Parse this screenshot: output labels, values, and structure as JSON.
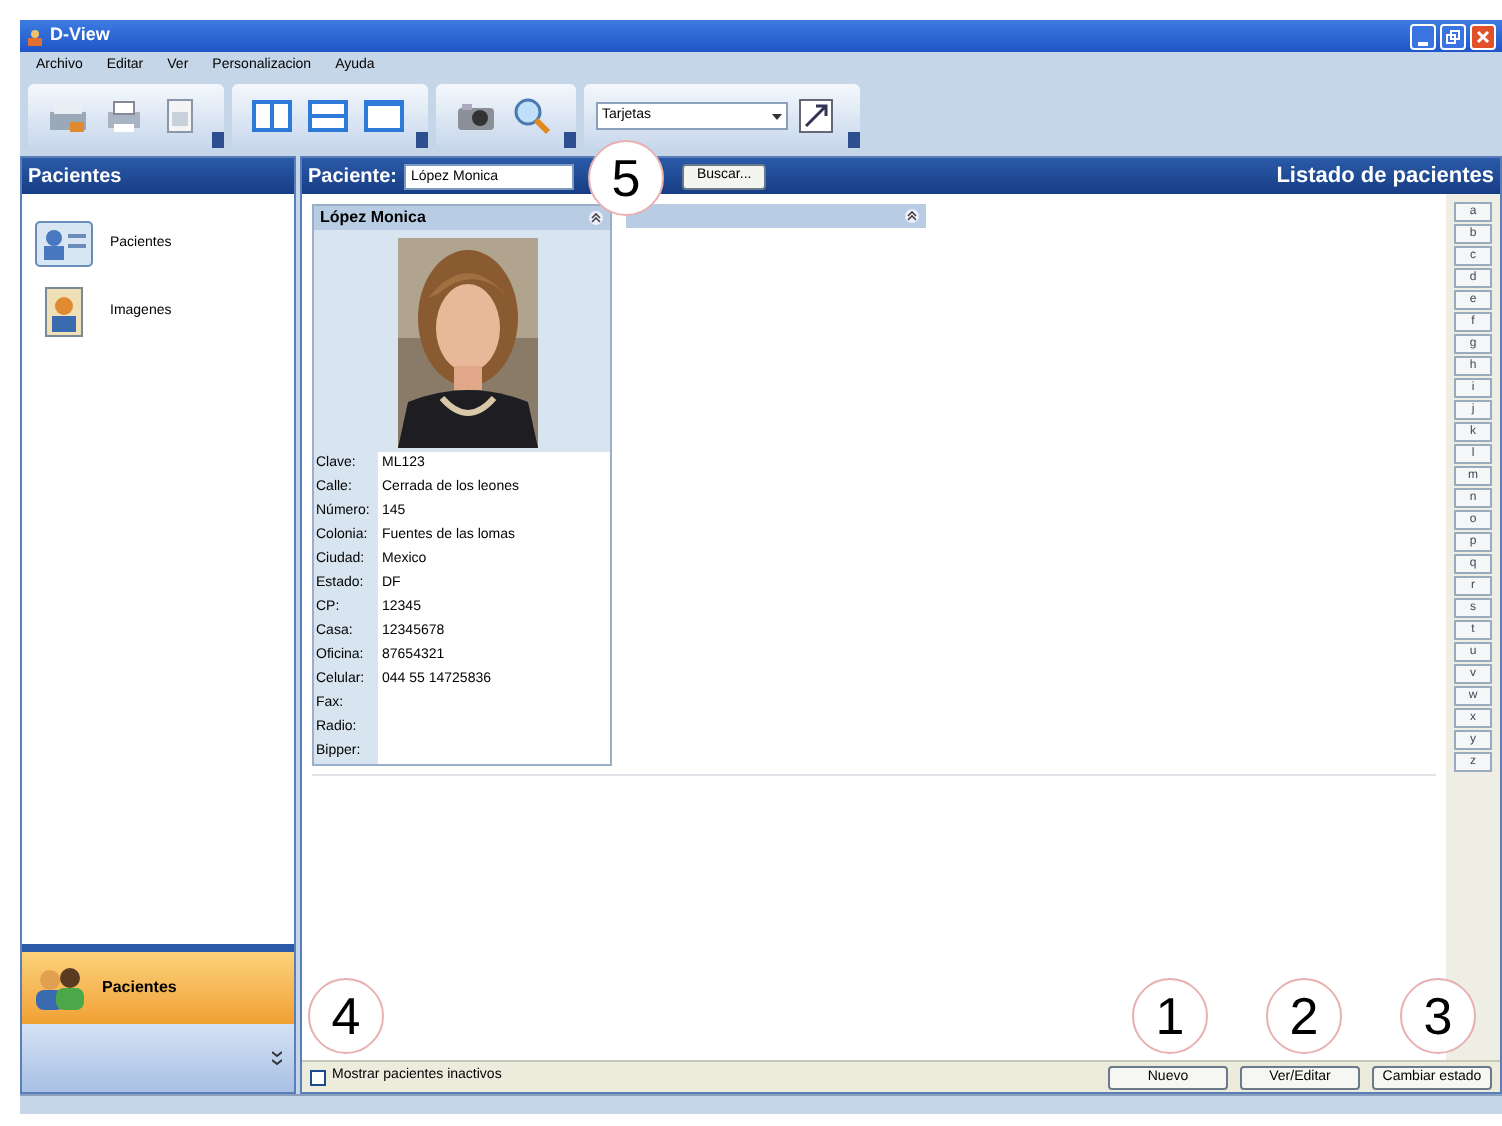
{
  "window": {
    "title": "D-View"
  },
  "menu": [
    "Archivo",
    "Editar",
    "Ver",
    "Personalizacion",
    "Ayuda"
  ],
  "toolbar": {
    "view_select": "Tarjetas"
  },
  "sidebar": {
    "title": "Pacientes",
    "items": [
      {
        "label": "Pacientes",
        "kind": "patients"
      },
      {
        "label": "Imagenes",
        "kind": "images"
      }
    ],
    "active_section": "Pacientes"
  },
  "search": {
    "label": "Paciente:",
    "value": "López Monica",
    "button": "Buscar..."
  },
  "list_title": "Listado de pacientes",
  "cards": [
    {
      "name": "López Monica",
      "photo": true,
      "fields": [
        {
          "label": "Clave:",
          "value": "ML123"
        },
        {
          "label": "Calle:",
          "value": "Cerrada de los leones"
        },
        {
          "label": "Número:",
          "value": "145"
        },
        {
          "label": "Colonia:",
          "value": "Fuentes de las lomas"
        },
        {
          "label": "Ciudad:",
          "value": "Mexico"
        },
        {
          "label": "Estado:",
          "value": "DF"
        },
        {
          "label": "CP:",
          "value": "12345"
        },
        {
          "label": "Casa:",
          "value": "12345678"
        },
        {
          "label": "Oficina:",
          "value": "87654321"
        },
        {
          "label": "Celular:",
          "value": "044 55 14725836"
        },
        {
          "label": "Fax:"
        },
        {
          "label": "Radio:"
        },
        {
          "label": "Bipper:"
        }
      ]
    },
    {
      "photo": false
    }
  ],
  "alphabet": [
    "a",
    "b",
    "c",
    "d",
    "e",
    "f",
    "g",
    "h",
    "i",
    "j",
    "k",
    "l",
    "m",
    "n",
    "o",
    "p",
    "q",
    "r",
    "s",
    "t",
    "u",
    "v",
    "w",
    "x",
    "y",
    "z"
  ],
  "inactive_checkbox": {
    "label": "Mostrar pacientes inactivos",
    "checked": false
  },
  "buttons": [
    "Nuevo",
    "Ver/Editar",
    "Cambiar estado"
  ],
  "callouts": [
    "5",
    "4",
    "1",
    "2",
    "3"
  ]
}
